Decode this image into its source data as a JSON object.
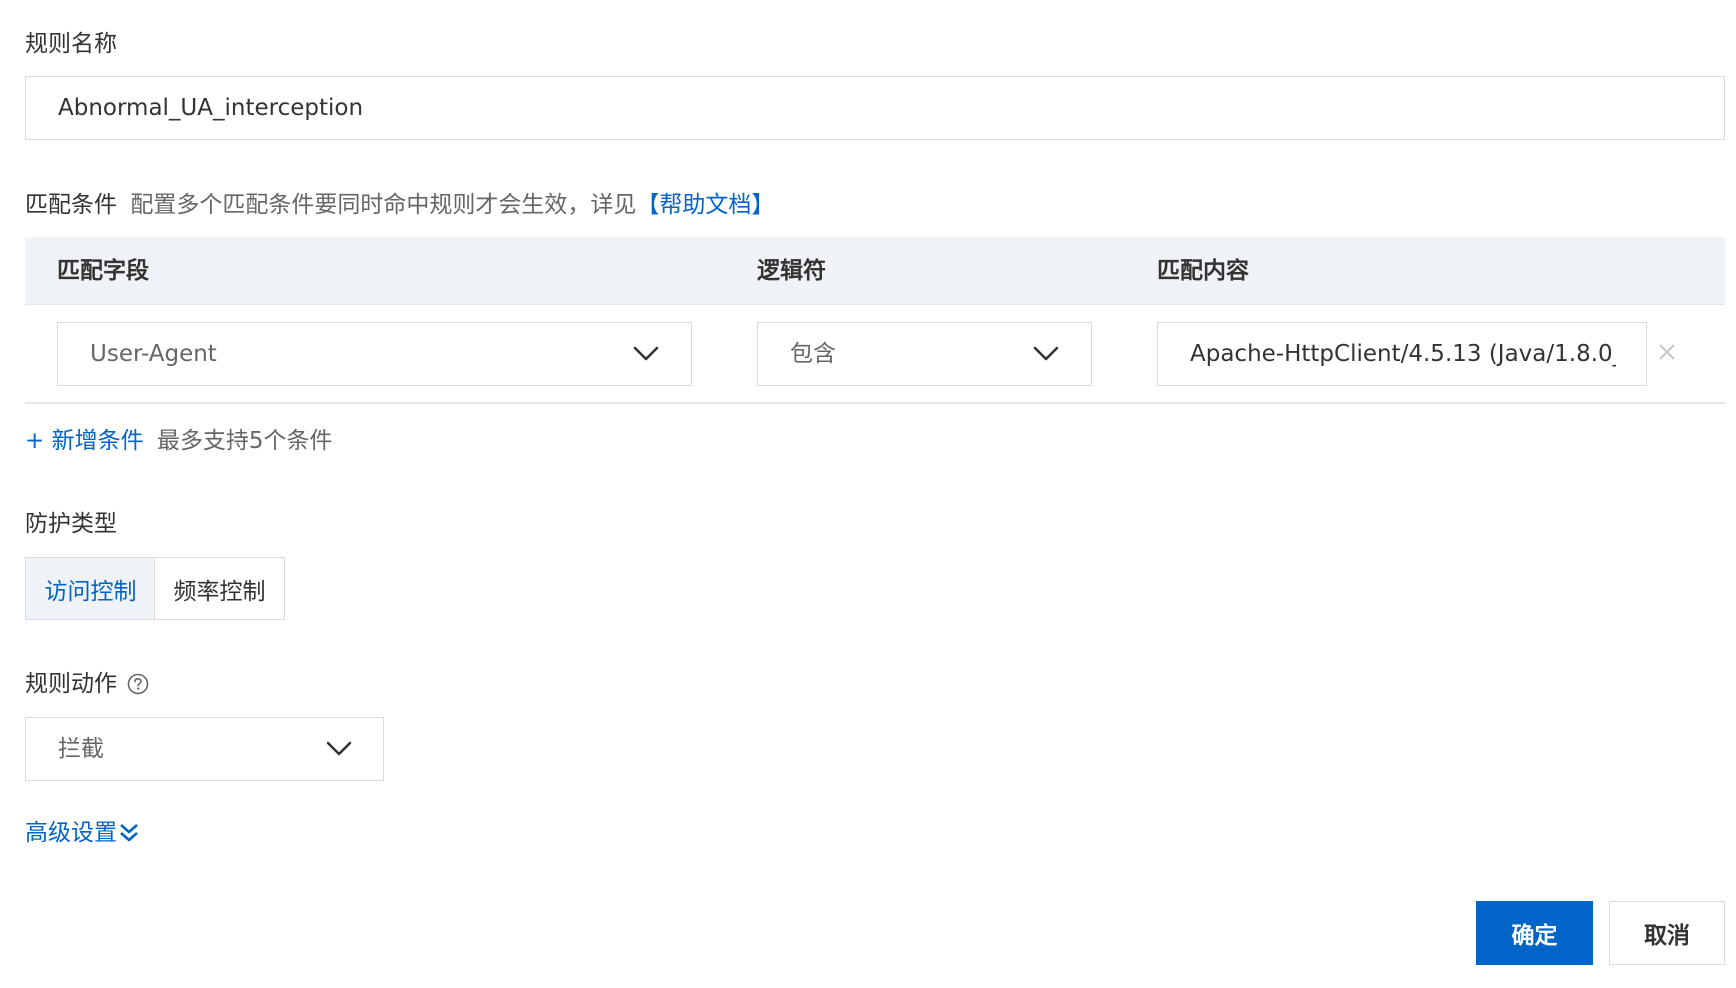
{
  "rule_name": {
    "label": "规则名称",
    "value": "Abnormal_UA_interception"
  },
  "match_conditions": {
    "label": "匹配条件",
    "description": "配置多个匹配条件要同时命中规则才会生效，详见",
    "help_link": "【帮助文档】",
    "columns": {
      "field": "匹配字段",
      "operator": "逻辑符",
      "content": "匹配内容"
    },
    "rows": [
      {
        "field": "User-Agent",
        "operator": "包含",
        "content": "Apache-HttpClient/4.5.13 (Java/1.8.0_"
      }
    ],
    "add_label": "+ 新增条件",
    "add_hint": "最多支持5个条件"
  },
  "protection_type": {
    "label": "防护类型",
    "options": [
      "访问控制",
      "频率控制"
    ],
    "selected": "访问控制"
  },
  "rule_action": {
    "label": "规则动作",
    "value": "拦截",
    "help_icon": "question-circle-icon"
  },
  "advanced_settings": {
    "label": "高级设置",
    "icon": "double-chevron-down-icon"
  },
  "footer": {
    "confirm_label": "确定",
    "cancel_label": "取消"
  },
  "colors": {
    "primary": "#0064c8",
    "table_header_bg": "#eff2f6",
    "border": "#d9dbe0"
  }
}
